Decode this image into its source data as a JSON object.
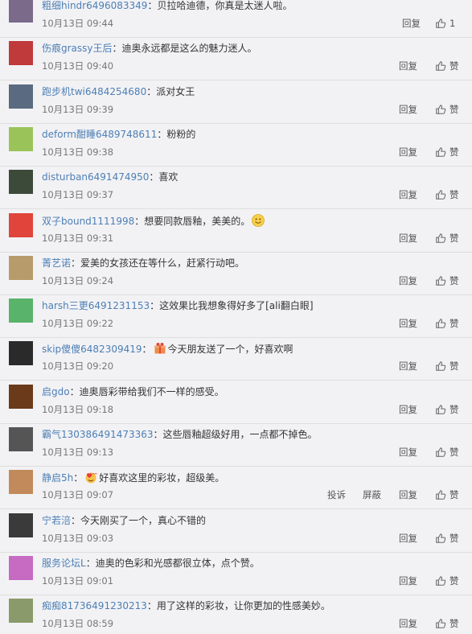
{
  "comments": [
    {
      "user": "粗细hindr6496083349",
      "text": "贝拉哈迪德，你真是太迷人啦。",
      "time": "10月13日 09:44",
      "reply": "回复",
      "like": "1",
      "avatar_color": "#7b6a8a"
    },
    {
      "user": "伤痕grassy王后",
      "text": "迪奥永远都是这么的魅力迷人。",
      "time": "10月13日 09:40",
      "reply": "回复",
      "like": "赞",
      "avatar_color": "#c0393b"
    },
    {
      "user": "跑步机twi6484254680",
      "text": "派对女王",
      "time": "10月13日 09:39",
      "reply": "回复",
      "like": "赞",
      "avatar_color": "#5a6a80"
    },
    {
      "user": "deform酣睡6489748611",
      "text": "粉粉的",
      "time": "10月13日 09:38",
      "reply": "回复",
      "like": "赞",
      "avatar_color": "#9ac35a"
    },
    {
      "user": "disturban6491474950",
      "text": "喜欢",
      "time": "10月13日 09:37",
      "reply": "回复",
      "like": "赞",
      "avatar_color": "#3c4a3a"
    },
    {
      "user": "双子bound1111998",
      "text": "想要同款唇釉，美美的。",
      "time": "10月13日 09:31",
      "reply": "回复",
      "like": "赞",
      "avatar_color": "#e0443a",
      "emoji": "smile"
    },
    {
      "user": "菁艺诺",
      "text": "爱美的女孩还在等什么，赶紧行动吧。",
      "time": "10月13日 09:24",
      "reply": "回复",
      "like": "赞",
      "avatar_color": "#b79b6a"
    },
    {
      "user": "harsh三更6491231153",
      "text": "这效果比我想象得好多了[ali翻白眼]",
      "time": "10月13日 09:22",
      "reply": "回复",
      "like": "赞",
      "avatar_color": "#5ab36a"
    },
    {
      "user": "skip傻傻6482309419",
      "text": "今天朋友送了一个，好喜欢啊",
      "time": "10月13日 09:20",
      "reply": "回复",
      "like": "赞",
      "avatar_color": "#2a2a2a",
      "emoji": "gift"
    },
    {
      "user": "启gdo",
      "text": "迪奥唇彩带给我们不一样的感受。",
      "time": "10月13日 09:18",
      "reply": "回复",
      "like": "赞",
      "avatar_color": "#6a3a1a"
    },
    {
      "user": "霸气130386491473363",
      "text": "这些唇釉超级好用，一点都不掉色。",
      "time": "10月13日 09:13",
      "reply": "回复",
      "like": "赞",
      "avatar_color": "#555"
    },
    {
      "user": "静启5h",
      "text": "好喜欢这里的彩妆，超级美。",
      "time": "10月13日 09:07",
      "reply": "回复",
      "like": "赞",
      "avatar_color": "#c28a5a",
      "emoji": "heart",
      "report": "投诉",
      "block": "屏蔽"
    },
    {
      "user": "宁若涪",
      "text": "今天刚买了一个，真心不错的",
      "time": "10月13日 09:03",
      "reply": "回复",
      "like": "赞",
      "avatar_color": "#3a3a3a"
    },
    {
      "user": "服务论坛L",
      "text": "迪奥的色彩和光感都很立体，点个赞。",
      "time": "10月13日 09:01",
      "reply": "回复",
      "like": "赞",
      "avatar_color": "#c66ac2"
    },
    {
      "user": "痴痴81736491230213",
      "text": "用了这样的彩妆，让你更加的性感美妙。",
      "time": "10月13日 08:59",
      "reply": "回复",
      "like": "赞",
      "avatar_color": "#8a9a6a"
    }
  ]
}
